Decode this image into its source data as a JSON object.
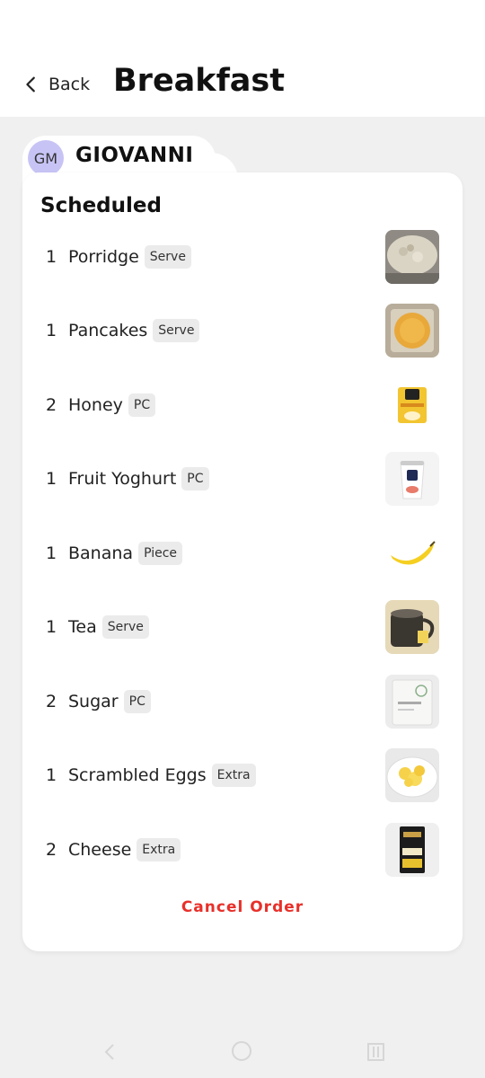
{
  "header": {
    "back_label": "Back",
    "title": "Breakfast"
  },
  "resident": {
    "initials": "GM",
    "name": "GIOVANNI"
  },
  "section": {
    "title": "Scheduled"
  },
  "items": [
    {
      "qty": "1",
      "name": "Porridge",
      "unit": "Serve",
      "image": "porridge"
    },
    {
      "qty": "1",
      "name": "Pancakes",
      "unit": "Serve",
      "image": "pancakes"
    },
    {
      "qty": "2",
      "name": "Honey",
      "unit": "PC",
      "image": "honey-packet"
    },
    {
      "qty": "1",
      "name": "Fruit Yoghurt",
      "unit": "PC",
      "image": "yoghurt-cup"
    },
    {
      "qty": "1",
      "name": "Banana",
      "unit": "Piece",
      "image": "banana"
    },
    {
      "qty": "1",
      "name": "Tea",
      "unit": "Serve",
      "image": "tea-mug"
    },
    {
      "qty": "2",
      "name": "Sugar",
      "unit": "PC",
      "image": "sugar-packet"
    },
    {
      "qty": "1",
      "name": "Scrambled Eggs",
      "unit": "Extra",
      "image": "scrambled-eggs"
    },
    {
      "qty": "2",
      "name": "Cheese",
      "unit": "Extra",
      "image": "cheese-pack"
    }
  ],
  "actions": {
    "cancel_label": "Cancel Order"
  },
  "colors": {
    "accent_red": "#e8302a",
    "avatar_bg": "#c7c4f5",
    "background": "#f0f0f0"
  }
}
